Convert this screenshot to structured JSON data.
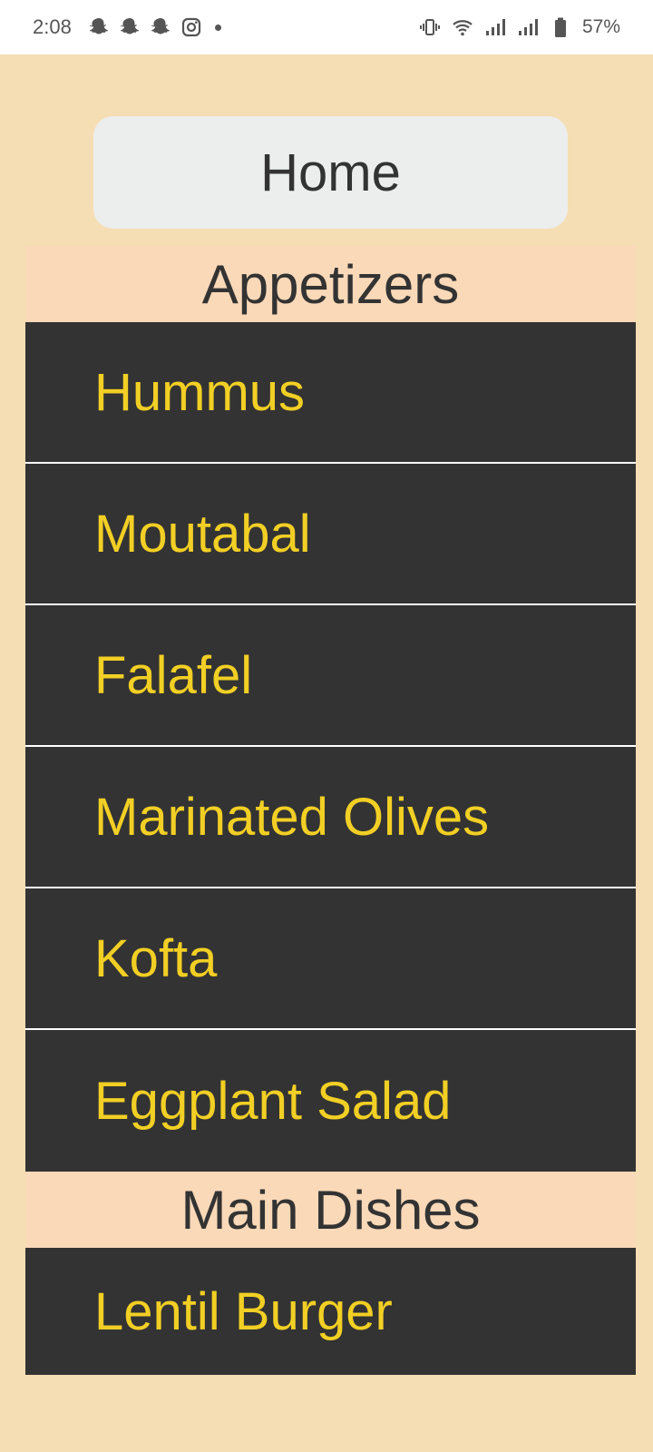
{
  "status_bar": {
    "time": "2:08",
    "left_icons": [
      "snapchat-ghost-icon",
      "snapchat-ghost-icon",
      "snapchat-ghost-icon",
      "instagram-icon",
      "notification-dot"
    ],
    "right_icons": [
      "vibrate-icon",
      "wifi-icon",
      "signal-icon",
      "signal-icon",
      "battery-icon"
    ],
    "battery": "57%"
  },
  "home_button": {
    "label": "Home"
  },
  "sections": [
    {
      "title": "Appetizers",
      "items": [
        "Hummus",
        "Moutabal",
        "Falafel",
        "Marinated Olives",
        "Kofta",
        "Eggplant Salad"
      ]
    },
    {
      "title": "Main Dishes",
      "items": [
        "Lentil Burger"
      ]
    }
  ],
  "colors": {
    "background": "#f5deb3",
    "section_header_bg": "#fad9b8",
    "item_bg": "#333333",
    "item_text": "#f2cf24",
    "home_button_bg": "#eceded"
  }
}
